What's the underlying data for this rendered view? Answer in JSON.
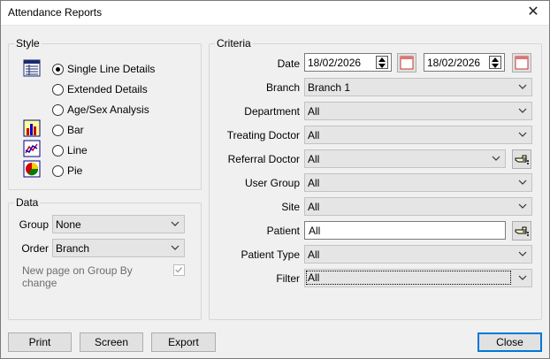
{
  "window": {
    "title": "Attendance Reports",
    "close_glyph": "✕"
  },
  "style_group": {
    "legend": "Style",
    "options": [
      {
        "label": "Single Line Details",
        "checked": true,
        "icon": "table-icon"
      },
      {
        "label": "Extended Details",
        "checked": false,
        "icon": ""
      },
      {
        "label": "Age/Sex Analysis",
        "checked": false,
        "icon": ""
      },
      {
        "label": "Bar",
        "checked": false,
        "icon": "bar-chart-icon"
      },
      {
        "label": "Line",
        "checked": false,
        "icon": "line-chart-icon"
      },
      {
        "label": "Pie",
        "checked": false,
        "icon": "pie-chart-icon"
      }
    ]
  },
  "data_group": {
    "legend": "Data",
    "group_label": "Group",
    "group_value": "None",
    "order_label": "Order",
    "order_value": "Branch",
    "new_page_label": "New page on Group By change",
    "new_page_checked": true,
    "new_page_disabled": true
  },
  "criteria_group": {
    "legend": "Criteria",
    "date_label": "Date",
    "date_from": "18/02/2026",
    "date_to": "18/02/2026",
    "fields": [
      {
        "label": "Branch",
        "value": "Branch 1",
        "kind": "combo"
      },
      {
        "label": "Department",
        "value": "All",
        "kind": "combo"
      },
      {
        "label": "Treating Doctor",
        "value": "All",
        "kind": "combo"
      },
      {
        "label": "Referral Doctor",
        "value": "All",
        "kind": "combo-find"
      },
      {
        "label": "User Group",
        "value": "All",
        "kind": "combo"
      },
      {
        "label": "Site",
        "value": "All",
        "kind": "combo"
      },
      {
        "label": "Patient",
        "value": "All",
        "kind": "text-find"
      },
      {
        "label": "Patient Type",
        "value": "All",
        "kind": "combo"
      },
      {
        "label": "Filter",
        "value": "All",
        "kind": "combo-focus"
      }
    ]
  },
  "buttons": {
    "print": "Print",
    "screen": "Screen",
    "export": "Export",
    "close": "Close"
  },
  "colors": {
    "accent": "#0078d7",
    "window_bg": "#f0f0f0",
    "combo_bg": "#e5e5e5"
  }
}
